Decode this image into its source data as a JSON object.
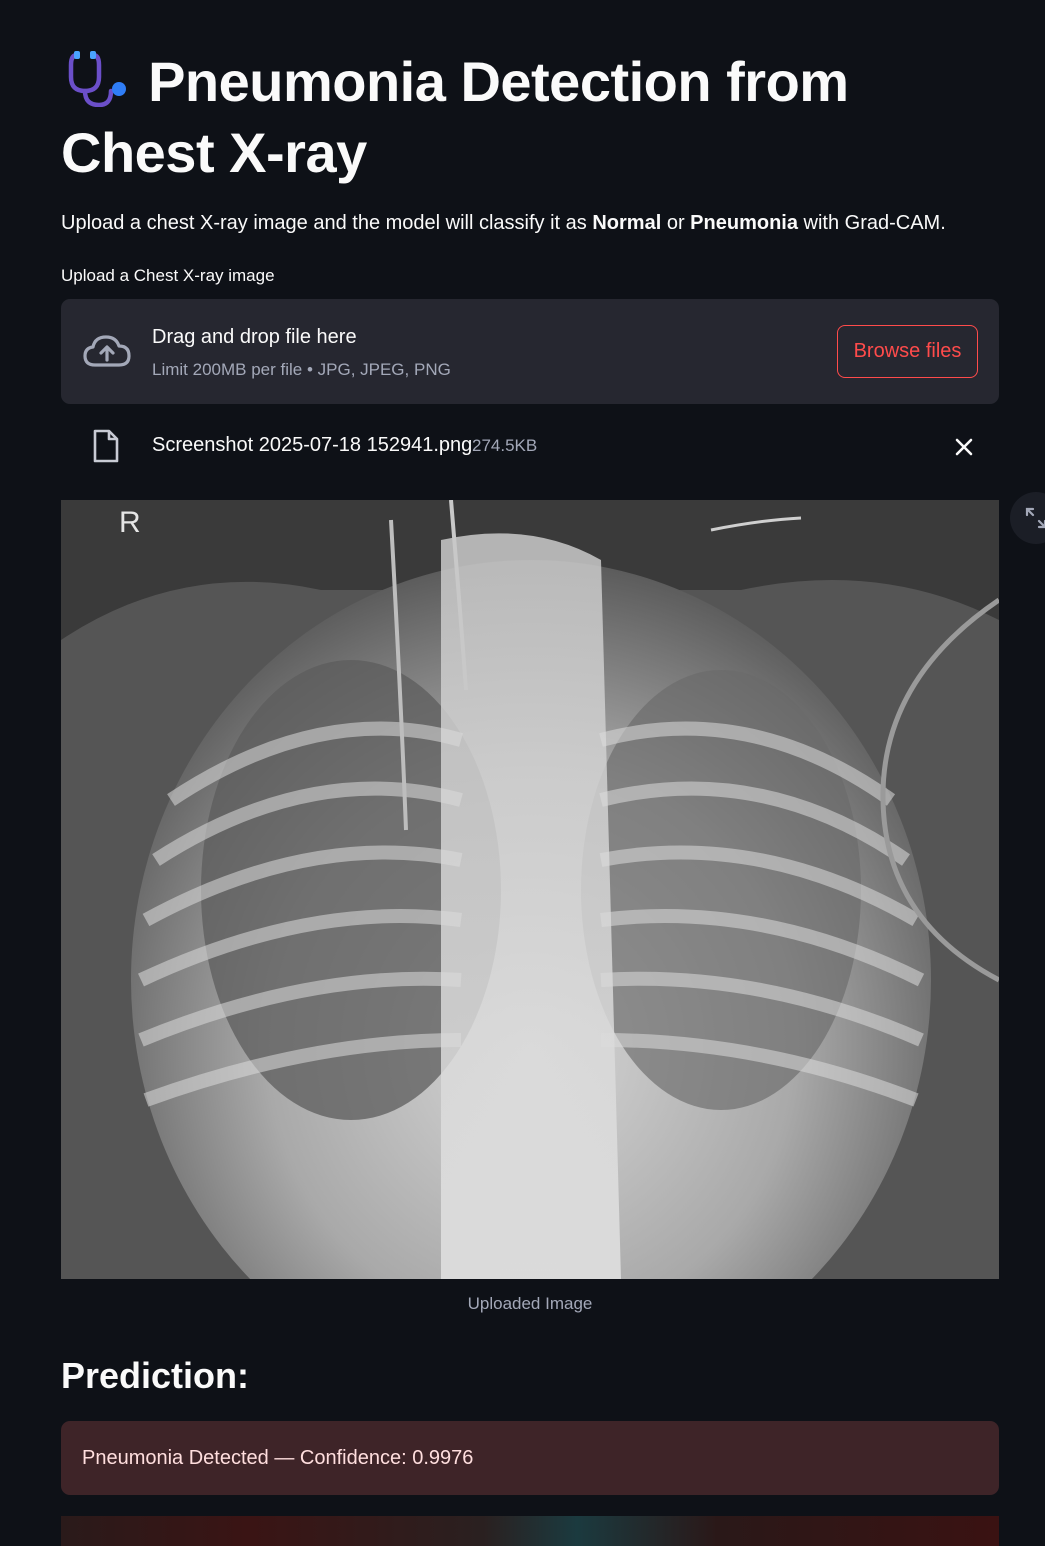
{
  "header": {
    "icon": "stethoscope-icon",
    "title": "Pneumonia Detection from Chest X-ray"
  },
  "intro": {
    "before": "Upload a chest X-ray image and the model will classify it as ",
    "normal": "Normal",
    "or": " or ",
    "pneumonia": "Pneumonia",
    "after": " with Grad-CAM."
  },
  "uploader": {
    "label": "Upload a Chest X-ray image",
    "drop_title": "Drag and drop file here",
    "drop_limit": "Limit 200MB per file • JPG, JPEG, PNG",
    "browse_label": "Browse files",
    "icon": "cloud-upload-icon"
  },
  "file": {
    "name": "Screenshot 2025-07-18 152941.png",
    "size": "274.5KB",
    "icon": "file-icon"
  },
  "image": {
    "marker": "R",
    "caption": "Uploaded Image"
  },
  "prediction": {
    "heading": "Prediction:",
    "result": "Pneumonia Detected — Confidence: 0.9976"
  },
  "colors": {
    "background": "#0e1117",
    "dropzone": "#262730",
    "accent": "#ff4b4b",
    "alert_bg": "#3e2428"
  }
}
